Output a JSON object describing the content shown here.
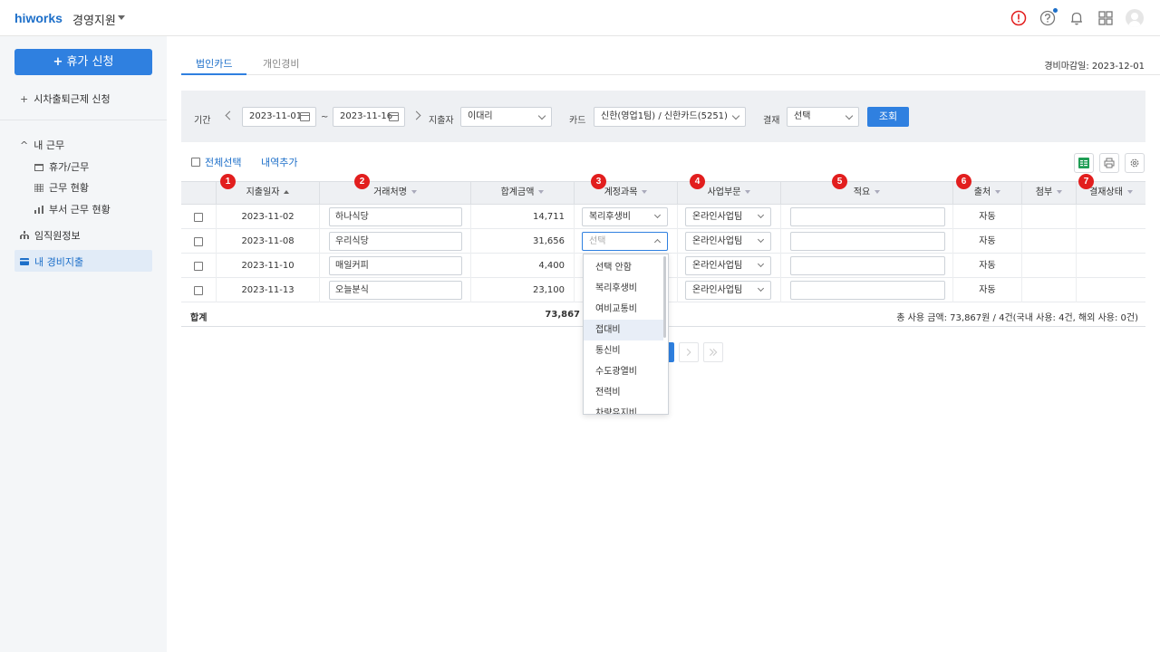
{
  "header": {
    "logo": "hiworks",
    "app_name": "경영지원",
    "icons": [
      "alert-icon",
      "help-icon",
      "bell-icon",
      "apps-grid-icon",
      "avatar"
    ]
  },
  "sidebar": {
    "primary_button": "휴가 신청",
    "primary_button_icon": "+",
    "attendance_link": "시차출퇴근제 신청",
    "section_title": "내 근무",
    "sub_items": [
      "휴가/근무",
      "근무 현황",
      "부서 근무 현황"
    ],
    "employee_info": "임직원정보",
    "active_item": "내 경비지출"
  },
  "tabs": [
    {
      "label": "법인카드",
      "active": true
    },
    {
      "label": "개인경비",
      "active": false
    }
  ],
  "deadline": "경비마감일: 2023-12-01",
  "filters": {
    "period_label": "기간",
    "start_date": "2023-11-01",
    "tilde": "~",
    "end_date": "2023-11-16",
    "spender_label": "지출자",
    "spender_value": "이대리",
    "card_label": "카드",
    "card_value": "신한(영업1팀) / 신한카드(5251)",
    "approval_label": "결재",
    "approval_value": "선택",
    "search_button": "조회"
  },
  "actions": {
    "select_all": "전체선택",
    "add_item": "내역추가"
  },
  "table": {
    "columns": [
      "지출일자",
      "거래처명",
      "합계금액",
      "계정과목",
      "사업부문",
      "적요",
      "출처",
      "첨부",
      "결재상태"
    ],
    "rows": [
      {
        "date": "2023-11-02",
        "vendor": "하나식당",
        "amount": "14,711",
        "account": "복리후생비",
        "division": "온라인사업팀",
        "memo": "",
        "source": "자동"
      },
      {
        "date": "2023-11-08",
        "vendor": "우리식당",
        "amount": "31,656",
        "account": "선택",
        "division": "온라인사업팀",
        "memo": "",
        "source": "자동"
      },
      {
        "date": "2023-11-10",
        "vendor": "매일커피",
        "amount": "4,400",
        "account": "",
        "division": "온라인사업팀",
        "memo": "",
        "source": "자동"
      },
      {
        "date": "2023-11-13",
        "vendor": "오늘분식",
        "amount": "23,100",
        "account": "",
        "division": "온라인사업팀",
        "memo": "",
        "source": "자동"
      }
    ],
    "total_label": "합계",
    "total_amount": "73,867",
    "summary": "총 사용 금액: 73,867원 / 4건(국내 사용: 4건, 해외 사용: 0건)"
  },
  "dropdown": {
    "options": [
      "선택 안함",
      "복리후생비",
      "여비교통비",
      "접대비",
      "통신비",
      "수도광열비",
      "전력비",
      "차량유지비"
    ],
    "highlighted": "접대비"
  },
  "markers": [
    "1",
    "2",
    "3",
    "4",
    "5",
    "6",
    "7"
  ],
  "colors": {
    "accent": "#2f80e0",
    "marker": "#e21e1e",
    "alert": "#e21e1e"
  }
}
